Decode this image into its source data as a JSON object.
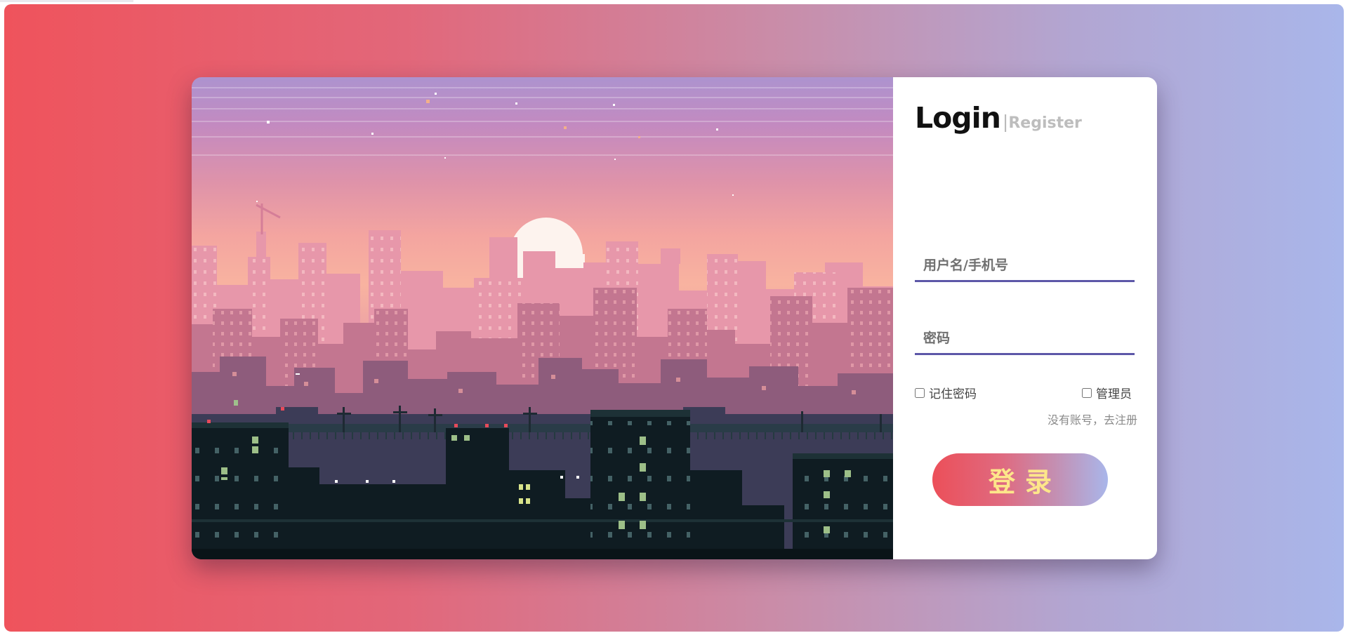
{
  "login": {
    "title": "Login",
    "separator": "|",
    "register_tab": "Register",
    "username_placeholder": "用户名/手机号",
    "password_placeholder": "密码",
    "remember_label": "记住密码",
    "admin_label": "管理员",
    "register_link": "没有账号，去注册",
    "submit_label": "登录"
  },
  "colors": {
    "background_start": "#ef535c",
    "background_end": "#a9b6ea",
    "input_underline": "#5d57a8",
    "button_text": "#fde68a"
  },
  "icons": {
    "checkbox_remember": "checkbox-unchecked",
    "checkbox_admin": "checkbox-unchecked"
  }
}
